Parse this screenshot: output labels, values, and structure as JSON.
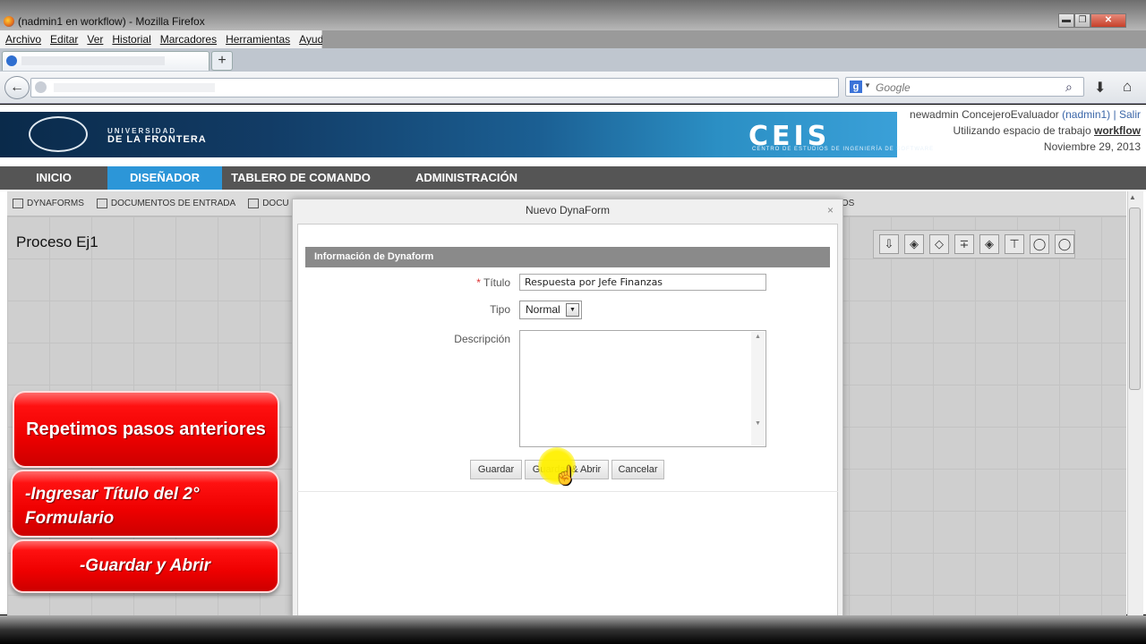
{
  "window": {
    "title": "(nadmin1 en workflow) - Mozilla Firefox",
    "buttons": {
      "minimize": "▬",
      "restore": "❐",
      "close": "✕"
    }
  },
  "menu": [
    "Archivo",
    "Editar",
    "Ver",
    "Historial",
    "Marcadores",
    "Herramientas",
    "Ayuda"
  ],
  "browser": {
    "newtab": "+",
    "search_placeholder": "Google",
    "search_engine_logo": "g",
    "icons": {
      "back": "←",
      "search": "⌕",
      "download": "⬇",
      "home": "⌂"
    }
  },
  "banner": {
    "ufro_line1": "UNIVERSIDAD",
    "ufro_line2": "DE LA FRONTERA",
    "ceis": "CEIS",
    "ceis_sub": "CENTRO DE ESTUDIOS DE INGENIERÍA DE SOFTWARE"
  },
  "user": {
    "name": "newadmin ConcejeroEvaluador",
    "login": "(nadmin1)",
    "sep": "|",
    "logout": "Salir",
    "workspace_label": "Utilizando espacio de trabajo",
    "workspace": "workflow",
    "date": "Noviembre 29, 2013"
  },
  "nav": [
    {
      "label": "INICIO"
    },
    {
      "label": "DISEÑADOR"
    },
    {
      "label": "TABLERO DE COMANDO"
    },
    {
      "label": "ADMINISTRACIÓN"
    }
  ],
  "toolbar": {
    "dynaforms": "DYNAFORMS",
    "input_docs": "DOCUMENTOS DE ENTRADA",
    "docs": "DOCU",
    "tail": "DOS"
  },
  "process": {
    "title": "Proceso Ej1"
  },
  "shape_tools": [
    "⇩",
    "◈",
    "◇",
    "∓",
    "◈",
    "⊤",
    "◯",
    "◯"
  ],
  "modal": {
    "title": "Nuevo DynaForm",
    "close": "×",
    "section": "Información de Dynaform",
    "required_mark": "*",
    "title_label": "Título",
    "title_value": "Respuesta por Jefe Finanzas",
    "type_label": "Tipo",
    "type_value": "Normal",
    "desc_label": "Descripción",
    "buttons": {
      "save": "Guardar",
      "save_open": "Guardar & Abrir",
      "cancel": "Cancelar"
    }
  },
  "callouts": {
    "c1": "Repetimos pasos anteriores",
    "c2": "-Ingresar  Título del 2° Formulario",
    "c3": "-Guardar y Abrir"
  }
}
